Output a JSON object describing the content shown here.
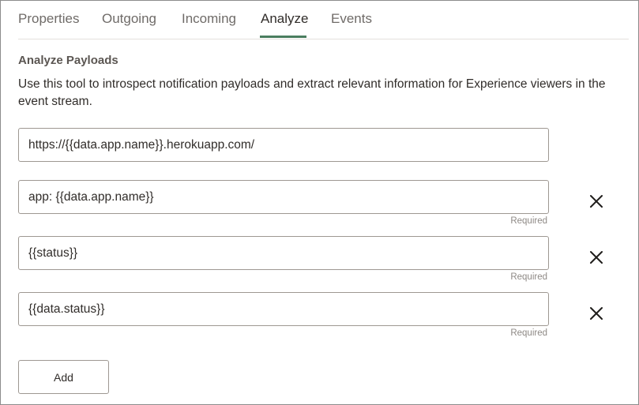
{
  "tabs": [
    {
      "label": "Properties",
      "active": false
    },
    {
      "label": "Outgoing",
      "active": false
    },
    {
      "label": "Incoming",
      "active": false
    },
    {
      "label": "Analyze",
      "active": true
    },
    {
      "label": "Events",
      "active": false
    }
  ],
  "analyze": {
    "title": "Analyze Payloads",
    "description": "Use this tool to introspect notification payloads and extract relevant information for Experience viewers in the event stream.",
    "url_field": {
      "value": "https://{{data.app.name}}.herokuapp.com/"
    },
    "expressions": [
      {
        "value": "app: {{data.app.name}}",
        "required_label": "Required"
      },
      {
        "value": "{{status}}",
        "required_label": "Required"
      },
      {
        "value": "{{data.status}}",
        "required_label": "Required"
      }
    ],
    "add_label": "Add"
  },
  "icons": {
    "remove": "close-icon"
  },
  "colors": {
    "active_tab_underline": "#4a7d5f",
    "text": "#312d2a",
    "muted_text": "#6f6b68",
    "border": "#9e9892"
  }
}
